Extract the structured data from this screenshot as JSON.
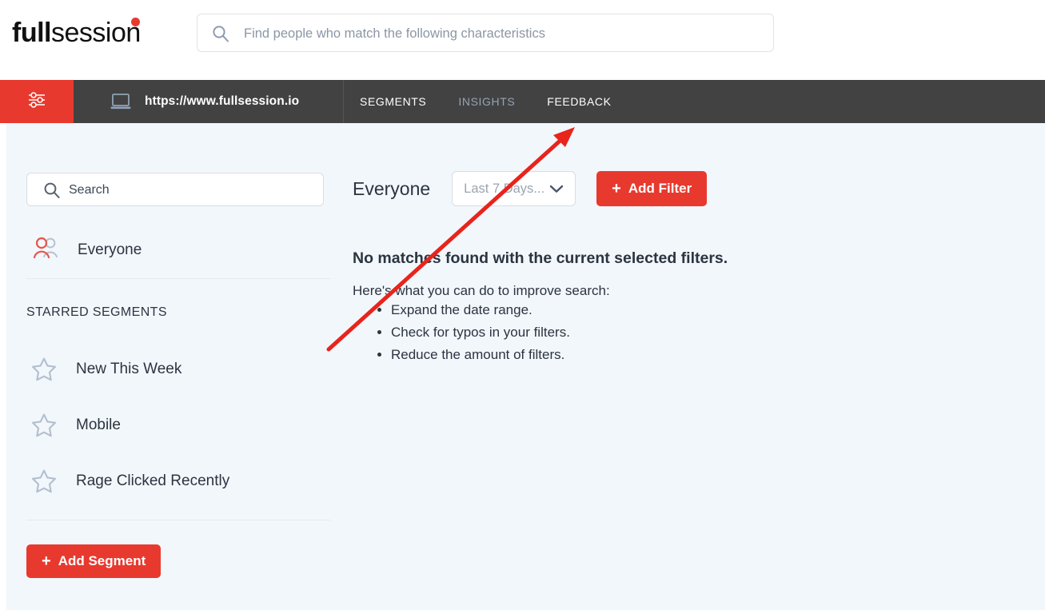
{
  "header": {
    "logo": {
      "bold_part": "full",
      "regular_part": "session",
      "dot_icon": "red-dot"
    },
    "search": {
      "placeholder": "Find people who match the following characteristics",
      "value": "",
      "icon": "search-icon"
    }
  },
  "navbar": {
    "filter_icon": "sliders-icon",
    "site_icon": "laptop-icon",
    "site_url": "https://www.fullsession.io",
    "links": [
      {
        "label": "SEGMENTS",
        "state": "active"
      },
      {
        "label": "INSIGHTS",
        "state": "muted"
      },
      {
        "label": "FEEDBACK",
        "state": "active"
      }
    ]
  },
  "sidebar": {
    "search": {
      "placeholder": "Search",
      "value": "",
      "icon": "search-icon"
    },
    "everyone": {
      "label": "Everyone",
      "icon": "people-icon"
    },
    "starred_title": "STARRED SEGMENTS",
    "segments": [
      {
        "label": "New This Week",
        "icon": "star-outline-icon"
      },
      {
        "label": "Mobile",
        "icon": "star-outline-icon"
      },
      {
        "label": "Rage Clicked Recently",
        "icon": "star-outline-icon"
      }
    ],
    "add_segment": {
      "label": "Add Segment",
      "plus": "+"
    }
  },
  "main": {
    "title": "Everyone",
    "date_filter": {
      "value": "Last 7 Days...",
      "icon": "chevron-down-icon"
    },
    "add_filter": {
      "label": "Add Filter",
      "plus": "+"
    },
    "empty_state": {
      "title": "No matches found with the current selected filters.",
      "subtitle": "Here's what you can do to improve search:",
      "tips": [
        "Expand the date range.",
        "Check for typos in your filters.",
        "Reduce the amount of filters."
      ]
    }
  },
  "annotation": {
    "arrow_color": "#e8241c",
    "points_to": "FEEDBACK"
  },
  "colors": {
    "accent_red": "#e8392e",
    "navbar_dark": "#424242",
    "page_bg": "#f2f7fc",
    "text_dark": "#2c3440",
    "muted_link": "#93a4b5"
  }
}
